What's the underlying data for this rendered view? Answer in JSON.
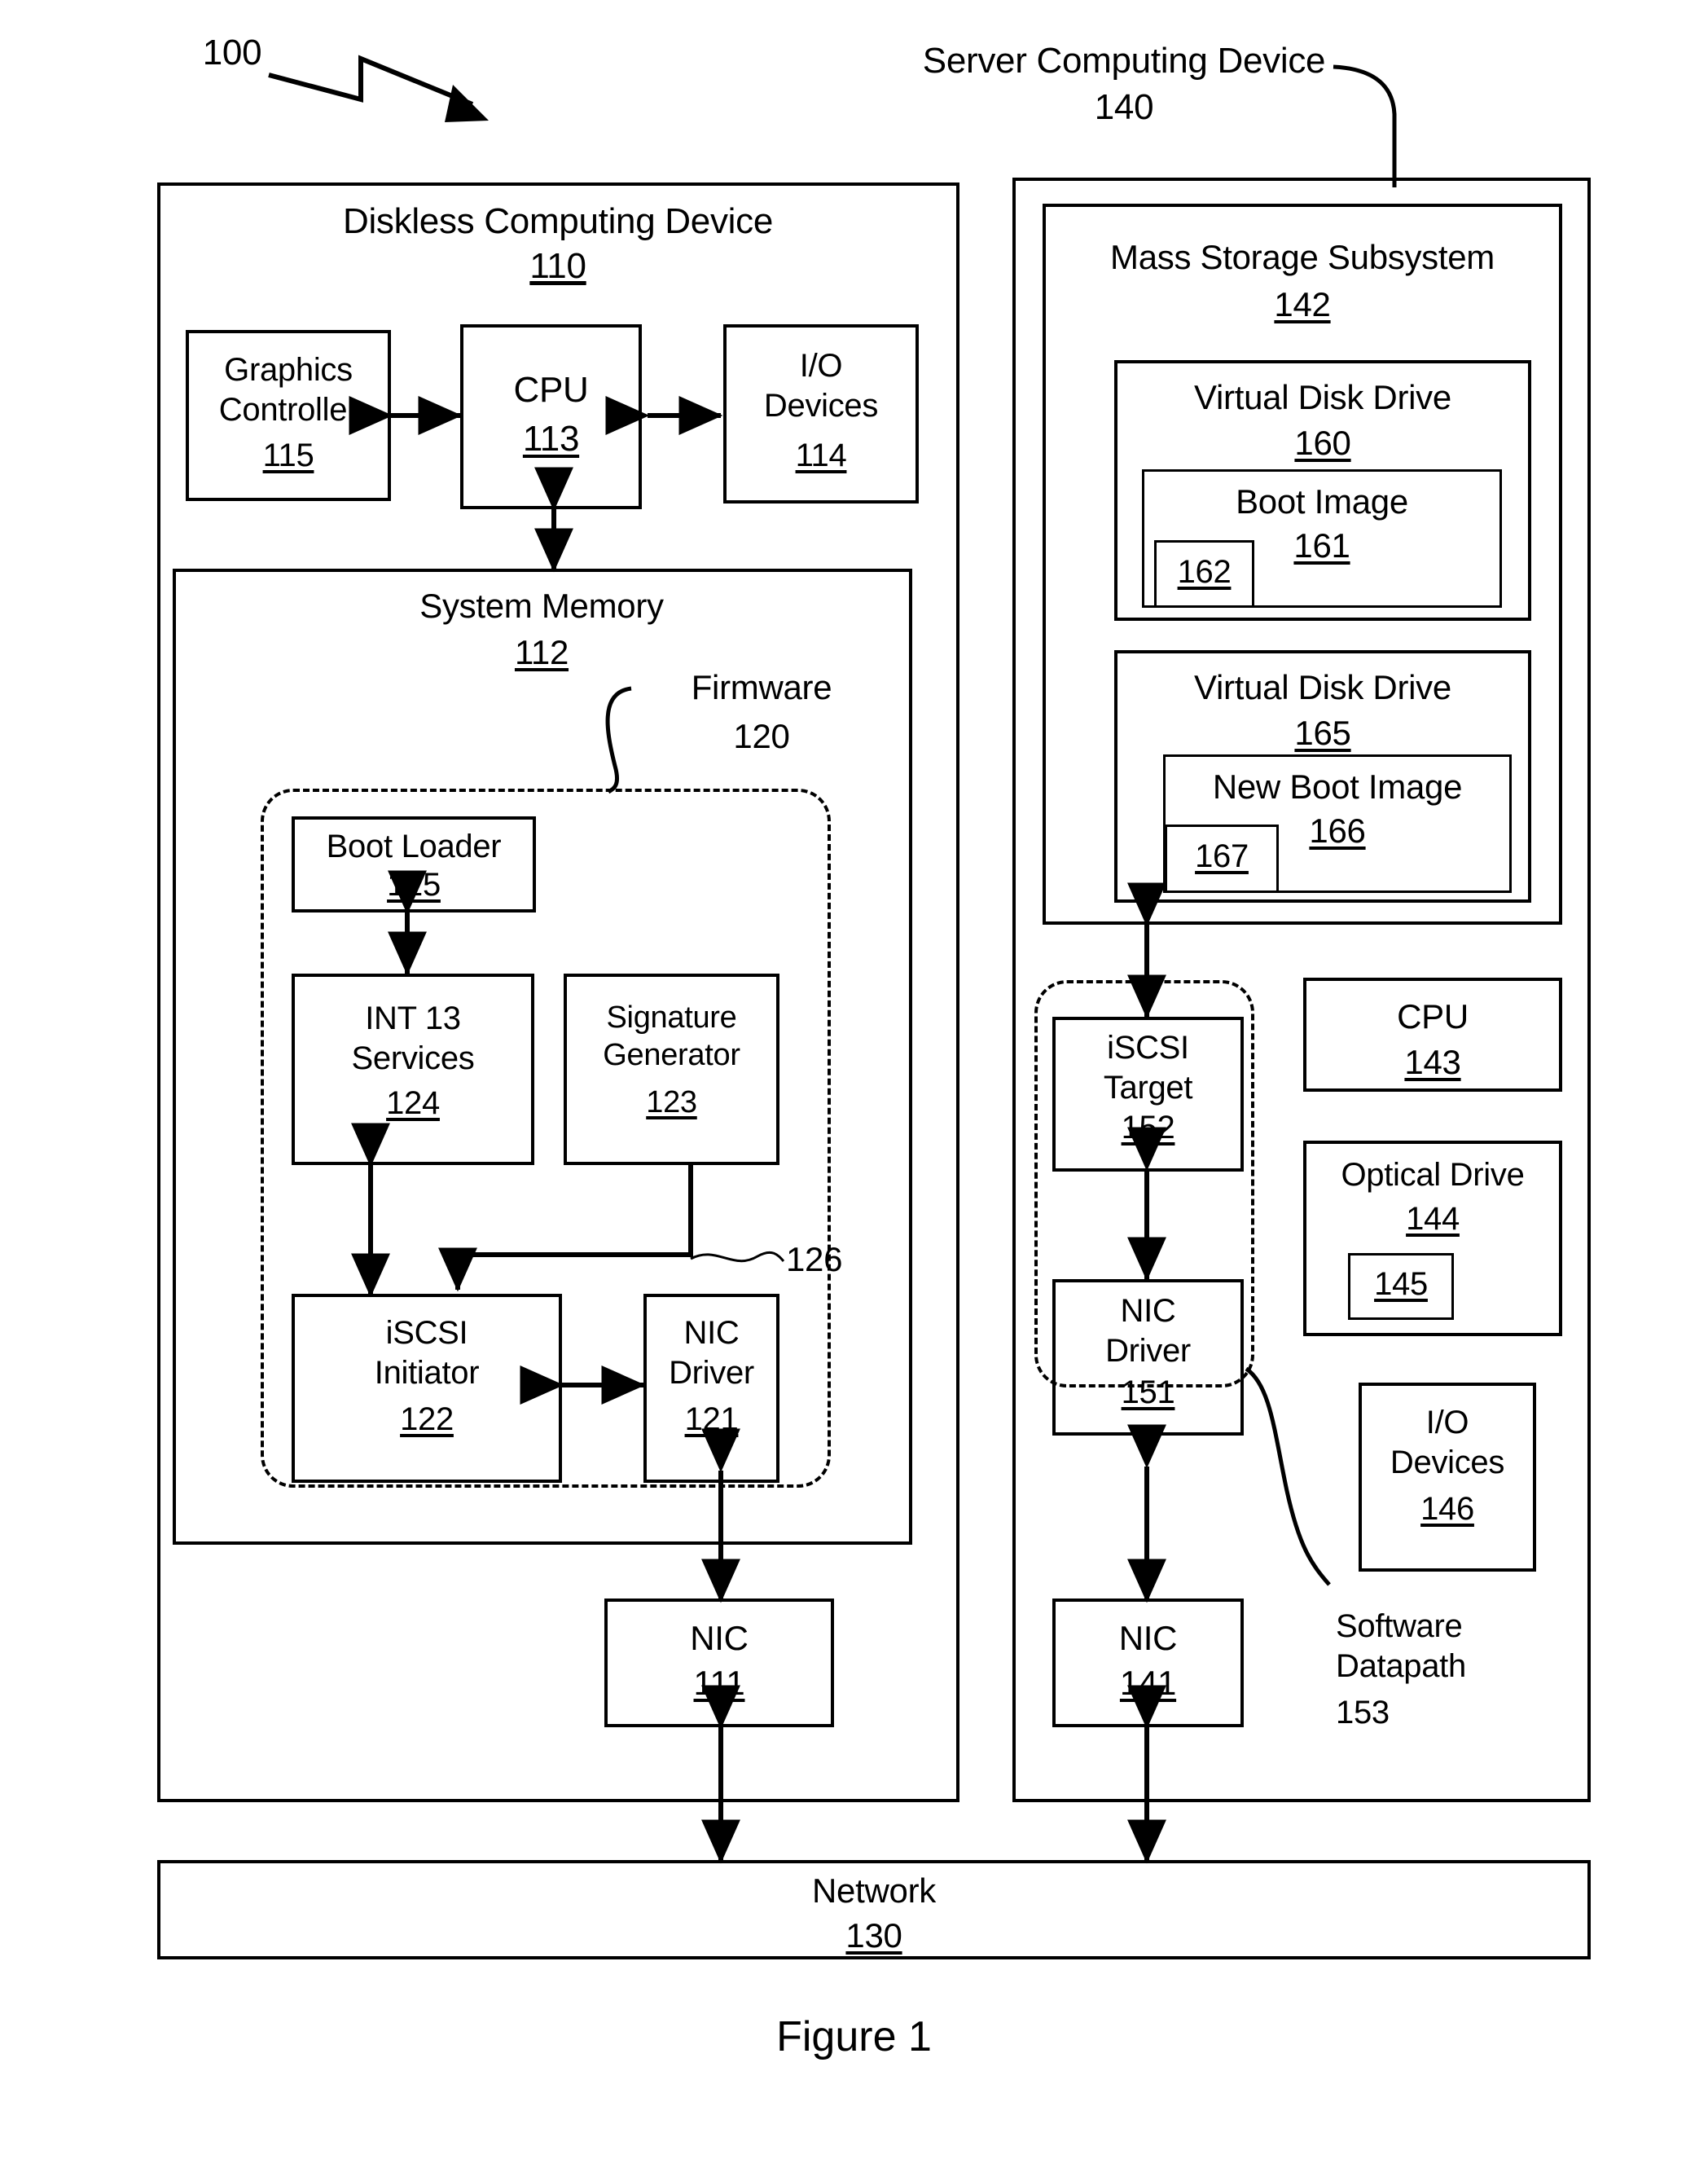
{
  "figure": {
    "caption": "Figure 1",
    "system_ref": "100"
  },
  "diskless_device": {
    "title": "Diskless Computing Device",
    "ref": "110",
    "graphics_controller": {
      "title": "Graphics\nController",
      "ref": "115"
    },
    "cpu": {
      "title": "CPU",
      "ref": "113"
    },
    "io_devices": {
      "title": "I/O\nDevices",
      "ref": "114"
    },
    "system_memory": {
      "title": "System Memory",
      "ref": "112",
      "firmware": {
        "label": "Firmware",
        "ref": "120",
        "boot_loader": {
          "title": "Boot Loader",
          "ref": "125"
        },
        "int13_services": {
          "title": "INT 13\nServices",
          "ref": "124"
        },
        "signature_generator": {
          "title": "Signature\nGenerator",
          "ref": "123"
        },
        "iscsi_initiator": {
          "title": "iSCSI\nInitiator",
          "ref": "122"
        },
        "nic_driver": {
          "title": "NIC\nDriver",
          "ref": "121"
        },
        "signature_path_ref": "126"
      }
    },
    "nic": {
      "title": "NIC",
      "ref": "111"
    }
  },
  "server_device": {
    "title": "Server Computing Device",
    "ref": "140",
    "mass_storage": {
      "title": "Mass Storage Subsystem",
      "ref": "142",
      "virtual_disk_1": {
        "title": "Virtual Disk Drive",
        "ref": "160",
        "boot_image": {
          "title": "Boot Image",
          "ref": "161",
          "inner_ref": "162"
        }
      },
      "virtual_disk_2": {
        "title": "Virtual Disk Drive",
        "ref": "165",
        "boot_image": {
          "title": "New Boot Image",
          "ref": "166",
          "inner_ref": "167"
        }
      }
    },
    "software_datapath": {
      "label": "Software\nDatapath",
      "ref": "153",
      "iscsi_target": {
        "title": "iSCSI\nTarget",
        "ref": "152"
      },
      "nic_driver": {
        "title": "NIC\nDriver",
        "ref": "151"
      }
    },
    "cpu": {
      "title": "CPU",
      "ref": "143"
    },
    "optical_drive": {
      "title": "Optical Drive",
      "ref": "144",
      "inner_ref": "145"
    },
    "io_devices": {
      "title": "I/O\nDevices",
      "ref": "146"
    },
    "nic": {
      "title": "NIC",
      "ref": "141"
    }
  },
  "network": {
    "title": "Network",
    "ref": "130"
  }
}
